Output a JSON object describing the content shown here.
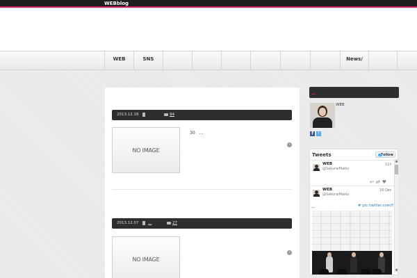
{
  "topbar": {
    "site_name": "WEBblog"
  },
  "nav": {
    "items": [
      "WEB",
      "SNS",
      "",
      "",
      "",
      "",
      "",
      "",
      "News/",
      ""
    ]
  },
  "posts": [
    {
      "date": "2013.12.18",
      "comments": "94",
      "category": "",
      "thumbnail_text": "NO IMAGE",
      "excerpt": "30　..."
    },
    {
      "date": "2013.12.07",
      "comments": "27",
      "category": "...",
      "thumbnail_text": "NO IMAGE",
      "excerpt": ""
    }
  ],
  "sidebar": {
    "author_name": "WEB",
    "social": {
      "facebook": "f",
      "twitter": "t"
    },
    "tweets_widget": {
      "title": "Tweets",
      "follow_label": "Follow",
      "tweets": [
        {
          "name": "WEB",
          "handle": "@SakuraiMaiko",
          "time": "11h"
        },
        {
          "name": "WEB",
          "handle": "@SakuraiMaiko",
          "time": "16 Dec",
          "text": "...",
          "link": "# pic.twitter.com/f"
        }
      ]
    }
  }
}
